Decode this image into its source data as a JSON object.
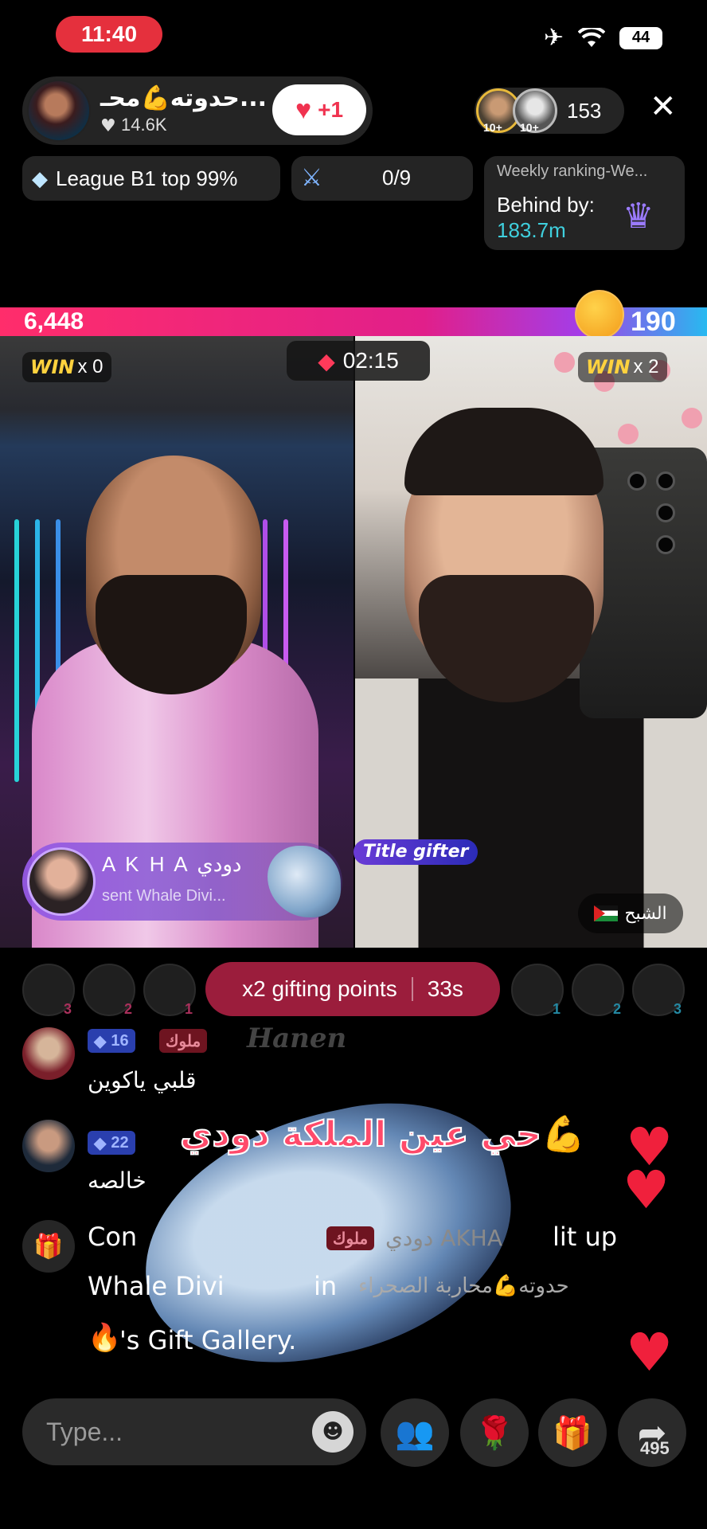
{
  "status_bar": {
    "time": "11:40",
    "battery": "44"
  },
  "host": {
    "name": "حدوته💪محـ...",
    "likes": "14.6K",
    "follow_label": "+1"
  },
  "viewers": {
    "badges": [
      "10+",
      "10+"
    ],
    "count": "153"
  },
  "league": {
    "label": "League B1 top 99%"
  },
  "progress": {
    "value": "0/9"
  },
  "ranking": {
    "title": "Weekly ranking-We...",
    "behind_label": "Behind by:",
    "behind_value": "183.7m"
  },
  "battle": {
    "left_score": "6,448",
    "right_score": "190",
    "timer": "02:15",
    "win_label": "WIN",
    "left_wins": "x 0",
    "right_wins": "x 2"
  },
  "gift_banner": {
    "sender": "A K H A دودي",
    "message": "sent Whale Divi..."
  },
  "title_gifter": "Title gifter",
  "opponent_name": "الشبح",
  "top_gifters": {
    "left_ranks": [
      "3",
      "2",
      "1"
    ],
    "right_ranks": [
      "1",
      "2",
      "3"
    ]
  },
  "gifting_points": {
    "label": "x2 gifting points",
    "time": "33s"
  },
  "chat": {
    "msg1": {
      "level": "16",
      "badge": "ملوك",
      "name": "Hanen",
      "text": "قلبي ياكوين"
    },
    "msg2": {
      "level": "22",
      "text": "خالصه"
    },
    "system": {
      "line1_start": "Con",
      "line1_mid": "ملوك",
      "line1_blur": "دودي AKHA",
      "line1_end": "lit up",
      "line2_start": "Whale Divi",
      "line2_in": "in",
      "line2_rtl": "حدوته💪محاربة الصحراء",
      "line3": "'s Gift Gallery."
    }
  },
  "overlay_text": "حي عين الملكة دودي💪",
  "input": {
    "placeholder": "Type..."
  },
  "share_count": "495",
  "colors": {
    "accent_pink": "#ff2d6b",
    "score_blue": "#28b9f0",
    "ranking_value": "#3fd0de",
    "win_yellow": "#ffd23e"
  }
}
